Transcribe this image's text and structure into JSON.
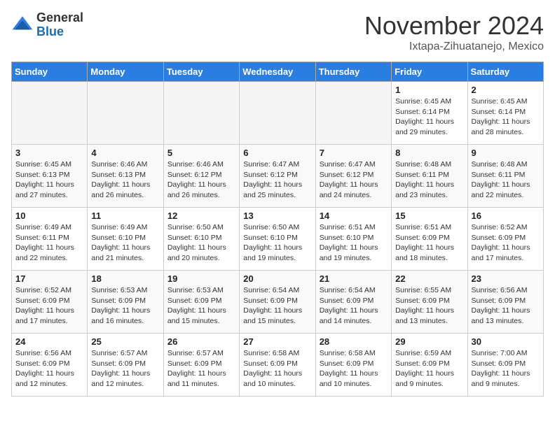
{
  "header": {
    "logo_general": "General",
    "logo_blue": "Blue",
    "month": "November 2024",
    "location": "Ixtapa-Zihuatanejo, Mexico"
  },
  "weekdays": [
    "Sunday",
    "Monday",
    "Tuesday",
    "Wednesday",
    "Thursday",
    "Friday",
    "Saturday"
  ],
  "weeks": [
    [
      {
        "day": "",
        "info": ""
      },
      {
        "day": "",
        "info": ""
      },
      {
        "day": "",
        "info": ""
      },
      {
        "day": "",
        "info": ""
      },
      {
        "day": "",
        "info": ""
      },
      {
        "day": "1",
        "info": "Sunrise: 6:45 AM\nSunset: 6:14 PM\nDaylight: 11 hours\nand 29 minutes."
      },
      {
        "day": "2",
        "info": "Sunrise: 6:45 AM\nSunset: 6:14 PM\nDaylight: 11 hours\nand 28 minutes."
      }
    ],
    [
      {
        "day": "3",
        "info": "Sunrise: 6:45 AM\nSunset: 6:13 PM\nDaylight: 11 hours\nand 27 minutes."
      },
      {
        "day": "4",
        "info": "Sunrise: 6:46 AM\nSunset: 6:13 PM\nDaylight: 11 hours\nand 26 minutes."
      },
      {
        "day": "5",
        "info": "Sunrise: 6:46 AM\nSunset: 6:12 PM\nDaylight: 11 hours\nand 26 minutes."
      },
      {
        "day": "6",
        "info": "Sunrise: 6:47 AM\nSunset: 6:12 PM\nDaylight: 11 hours\nand 25 minutes."
      },
      {
        "day": "7",
        "info": "Sunrise: 6:47 AM\nSunset: 6:12 PM\nDaylight: 11 hours\nand 24 minutes."
      },
      {
        "day": "8",
        "info": "Sunrise: 6:48 AM\nSunset: 6:11 PM\nDaylight: 11 hours\nand 23 minutes."
      },
      {
        "day": "9",
        "info": "Sunrise: 6:48 AM\nSunset: 6:11 PM\nDaylight: 11 hours\nand 22 minutes."
      }
    ],
    [
      {
        "day": "10",
        "info": "Sunrise: 6:49 AM\nSunset: 6:11 PM\nDaylight: 11 hours\nand 22 minutes."
      },
      {
        "day": "11",
        "info": "Sunrise: 6:49 AM\nSunset: 6:10 PM\nDaylight: 11 hours\nand 21 minutes."
      },
      {
        "day": "12",
        "info": "Sunrise: 6:50 AM\nSunset: 6:10 PM\nDaylight: 11 hours\nand 20 minutes."
      },
      {
        "day": "13",
        "info": "Sunrise: 6:50 AM\nSunset: 6:10 PM\nDaylight: 11 hours\nand 19 minutes."
      },
      {
        "day": "14",
        "info": "Sunrise: 6:51 AM\nSunset: 6:10 PM\nDaylight: 11 hours\nand 19 minutes."
      },
      {
        "day": "15",
        "info": "Sunrise: 6:51 AM\nSunset: 6:09 PM\nDaylight: 11 hours\nand 18 minutes."
      },
      {
        "day": "16",
        "info": "Sunrise: 6:52 AM\nSunset: 6:09 PM\nDaylight: 11 hours\nand 17 minutes."
      }
    ],
    [
      {
        "day": "17",
        "info": "Sunrise: 6:52 AM\nSunset: 6:09 PM\nDaylight: 11 hours\nand 17 minutes."
      },
      {
        "day": "18",
        "info": "Sunrise: 6:53 AM\nSunset: 6:09 PM\nDaylight: 11 hours\nand 16 minutes."
      },
      {
        "day": "19",
        "info": "Sunrise: 6:53 AM\nSunset: 6:09 PM\nDaylight: 11 hours\nand 15 minutes."
      },
      {
        "day": "20",
        "info": "Sunrise: 6:54 AM\nSunset: 6:09 PM\nDaylight: 11 hours\nand 15 minutes."
      },
      {
        "day": "21",
        "info": "Sunrise: 6:54 AM\nSunset: 6:09 PM\nDaylight: 11 hours\nand 14 minutes."
      },
      {
        "day": "22",
        "info": "Sunrise: 6:55 AM\nSunset: 6:09 PM\nDaylight: 11 hours\nand 13 minutes."
      },
      {
        "day": "23",
        "info": "Sunrise: 6:56 AM\nSunset: 6:09 PM\nDaylight: 11 hours\nand 13 minutes."
      }
    ],
    [
      {
        "day": "24",
        "info": "Sunrise: 6:56 AM\nSunset: 6:09 PM\nDaylight: 11 hours\nand 12 minutes."
      },
      {
        "day": "25",
        "info": "Sunrise: 6:57 AM\nSunset: 6:09 PM\nDaylight: 11 hours\nand 12 minutes."
      },
      {
        "day": "26",
        "info": "Sunrise: 6:57 AM\nSunset: 6:09 PM\nDaylight: 11 hours\nand 11 minutes."
      },
      {
        "day": "27",
        "info": "Sunrise: 6:58 AM\nSunset: 6:09 PM\nDaylight: 11 hours\nand 10 minutes."
      },
      {
        "day": "28",
        "info": "Sunrise: 6:58 AM\nSunset: 6:09 PM\nDaylight: 11 hours\nand 10 minutes."
      },
      {
        "day": "29",
        "info": "Sunrise: 6:59 AM\nSunset: 6:09 PM\nDaylight: 11 hours\nand 9 minutes."
      },
      {
        "day": "30",
        "info": "Sunrise: 7:00 AM\nSunset: 6:09 PM\nDaylight: 11 hours\nand 9 minutes."
      }
    ]
  ]
}
